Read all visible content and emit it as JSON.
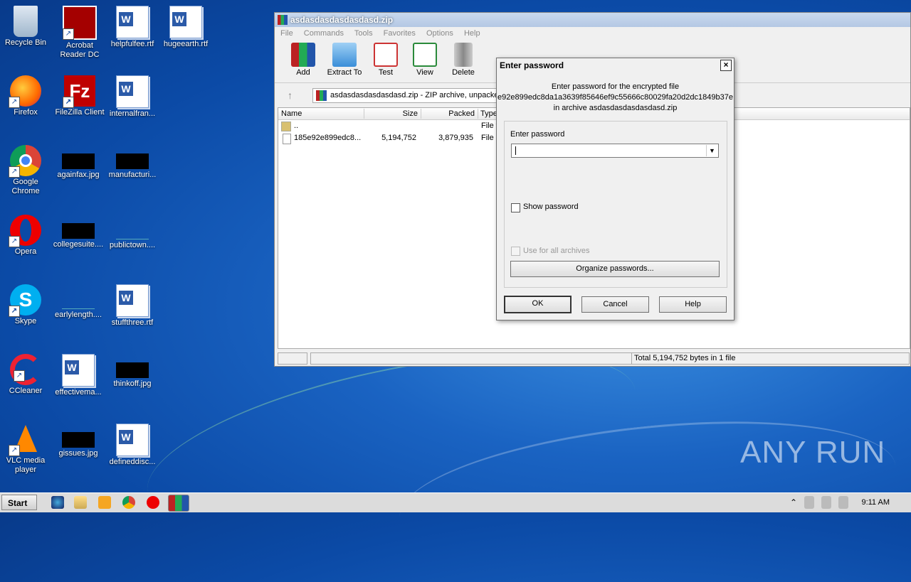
{
  "desktop": {
    "icons": [
      {
        "label": "Recycle Bin"
      },
      {
        "label": "Acrobat Reader DC"
      },
      {
        "label": "helpfulfee.rtf"
      },
      {
        "label": "hugeearth.rtf"
      },
      {
        "label": "Firefox"
      },
      {
        "label": "FileZilla Client"
      },
      {
        "label": "internalfran..."
      },
      {
        "label": "Google Chrome"
      },
      {
        "label": "againfax.jpg"
      },
      {
        "label": "manufacturi..."
      },
      {
        "label": "Opera"
      },
      {
        "label": "collegesuite...."
      },
      {
        "label": "publictown...."
      },
      {
        "label": "Skype"
      },
      {
        "label": "earlylength...."
      },
      {
        "label": "stuffthree.rtf"
      },
      {
        "label": "CCleaner"
      },
      {
        "label": "effectivema..."
      },
      {
        "label": "thinkoff.jpg"
      },
      {
        "label": "VLC media player"
      },
      {
        "label": "gissues.jpg"
      },
      {
        "label": "defineddisc..."
      }
    ]
  },
  "winrar": {
    "title": "asdasdasdasdasdasd.zip",
    "menu": [
      "File",
      "Commands",
      "Tools",
      "Favorites",
      "Options",
      "Help"
    ],
    "toolbar": [
      "Add",
      "Extract To",
      "Test",
      "View",
      "Delete"
    ],
    "address": "asdasdasdasdasdasd.zip - ZIP archive, unpacked",
    "columns": [
      "Name",
      "Size",
      "Packed",
      "Type"
    ],
    "rows": [
      {
        "name": "..",
        "size": "",
        "packed": "",
        "type": "File f"
      },
      {
        "name": "185e92e899edc8...",
        "size": "5,194,752",
        "packed": "3,879,935",
        "type": "File"
      }
    ],
    "status": "Total 5,194,752 bytes in 1 file"
  },
  "dialog": {
    "title": "Enter password",
    "msg1": "Enter password for the encrypted file",
    "msg2": "e92e899edc8da1a3639f85646ef9c55666c80029fa20d2dc1849b37e",
    "msg3": "in archive asdasdasdasdasdasd.zip",
    "field_label": "Enter password",
    "show_password": "Show password",
    "use_all": "Use for all archives",
    "organize": "Organize passwords...",
    "ok": "OK",
    "cancel": "Cancel",
    "help": "Help"
  },
  "taskbar": {
    "start": "Start",
    "clock": "9:11 AM"
  },
  "watermark": "ANY RUN"
}
